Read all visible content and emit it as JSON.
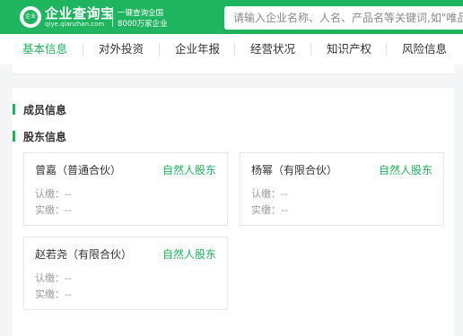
{
  "header": {
    "logo_badge": "企业",
    "logo_name": "企业查询宝",
    "logo_domain": "qiye.qianzhan.com",
    "slogan_line1": "一键查询全国",
    "slogan_line2": "8000万家企业",
    "search_placeholder": "请输入企业名称、人名、产品名等关键词,如\"唯品"
  },
  "nav": {
    "tabs": [
      {
        "label": "基本信息",
        "active": true
      },
      {
        "label": "对外投资",
        "active": false
      },
      {
        "label": "企业年报",
        "active": false
      },
      {
        "label": "经营状况",
        "active": false
      },
      {
        "label": "知识产权",
        "active": false
      },
      {
        "label": "风险信息",
        "active": false
      }
    ]
  },
  "sections": {
    "members_title": "成员信息",
    "shareholders_title": "股东信息"
  },
  "shareholders": [
    {
      "name": "曾嘉（普通合伙）",
      "type": "自然人股东",
      "subscribed": "认缴：--",
      "paid": "实缴：--"
    },
    {
      "name": "杨幂（有限合伙）",
      "type": "自然人股东",
      "subscribed": "认缴：--",
      "paid": "实缴：--"
    },
    {
      "name": "赵若尧（有限合伙）",
      "type": "自然人股东",
      "subscribed": "认缴：--",
      "paid": "实缴：--"
    }
  ],
  "colors": {
    "brand_green": "#1fb45e"
  }
}
